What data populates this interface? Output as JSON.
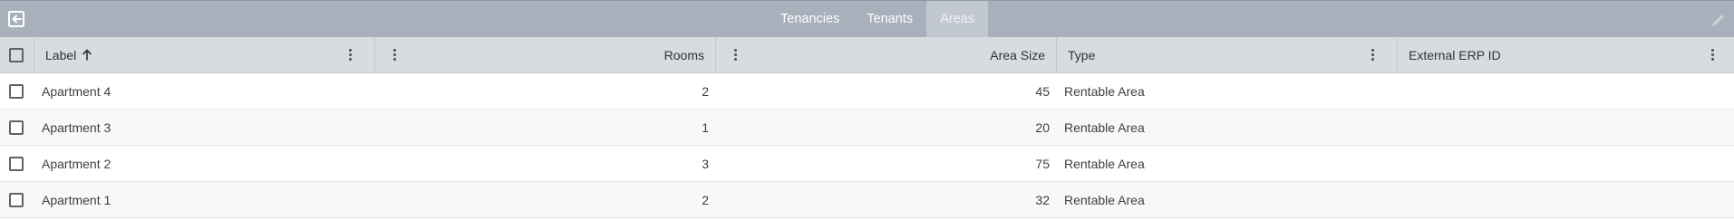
{
  "tabs": [
    {
      "label": "Tenancies",
      "active": false
    },
    {
      "label": "Tenants",
      "active": false
    },
    {
      "label": "Areas",
      "active": true
    }
  ],
  "icons": {
    "exit": "exit-icon",
    "edit": "pencil-icon",
    "sort": "arrow-up-icon",
    "menu": "kebab-menu-icon"
  },
  "colors": {
    "topbar": "#a8b0bc",
    "active_tab": "#c2c8d0",
    "header": "#d8dbe0"
  },
  "table": {
    "columns": [
      {
        "label": "Label",
        "sorted": "ascending"
      },
      {
        "label": "Rooms"
      },
      {
        "label": "Area Size"
      },
      {
        "label": "Type"
      },
      {
        "label": "External ERP ID"
      }
    ],
    "rows": [
      {
        "label": "Apartment 4",
        "rooms": "2",
        "area_size": "45",
        "type": "Rentable Area",
        "erp_id": ""
      },
      {
        "label": "Apartment 3",
        "rooms": "1",
        "area_size": "20",
        "type": "Rentable Area",
        "erp_id": ""
      },
      {
        "label": "Apartment 2",
        "rooms": "3",
        "area_size": "75",
        "type": "Rentable Area",
        "erp_id": ""
      },
      {
        "label": "Apartment 1",
        "rooms": "2",
        "area_size": "32",
        "type": "Rentable Area",
        "erp_id": ""
      }
    ]
  }
}
